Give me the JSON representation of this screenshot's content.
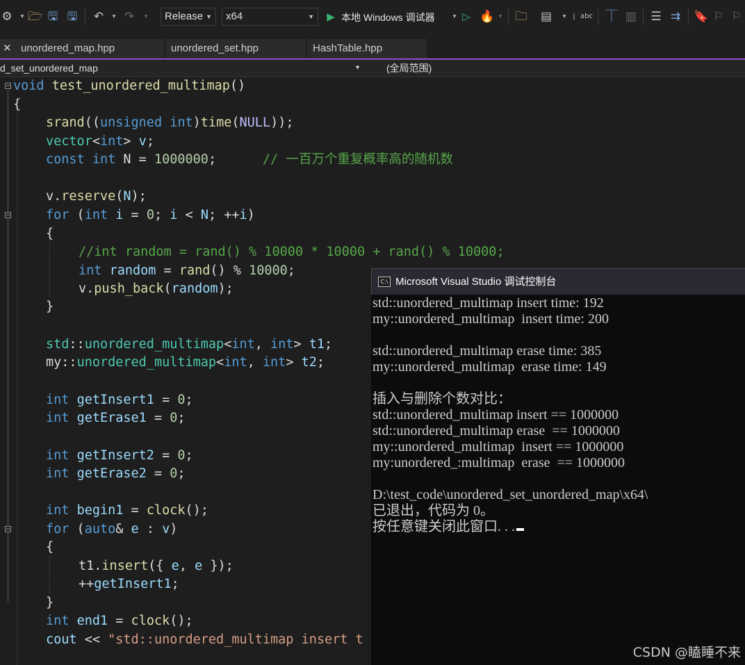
{
  "toolbar": {
    "configuration": "Release",
    "platform": "x64",
    "run_label": "本地 Windows 调试器",
    "icons": [
      "config-icon",
      "open-folder-icon",
      "save-icon",
      "save-all-icon",
      "undo-icon",
      "redo-icon",
      "play-icon",
      "play-outline-icon",
      "hot-reload-icon",
      "find-in-files-icon",
      "format-icon",
      "spellcheck-icon",
      "breakpoint-icon",
      "outdent-icon",
      "indent-icon",
      "comment-icon",
      "uncomment-icon",
      "bookmark-icon",
      "prev-bookmark-icon",
      "next-bookmark-icon"
    ]
  },
  "tabs": [
    {
      "label": "unordered_map.hpp"
    },
    {
      "label": "unordered_set.hpp"
    },
    {
      "label": "HashTable.hpp"
    }
  ],
  "navbar": {
    "project": "d_set_unordered_map",
    "scope": "(全局范围)"
  },
  "code": {
    "l01_a": "void",
    "l01_b": " ",
    "l01_c": "test_unordered_multimap",
    "l01_d": "()",
    "l02": "{",
    "l04_a": "srand",
    "l04_b": "((",
    "l04_c": "unsigned",
    "l04_d": " ",
    "l04_e": "int",
    "l04_f": ")",
    "l04_g": "time",
    "l04_h": "(",
    "l04_i": "NULL",
    "l04_j": "));",
    "l05_a": "vector",
    "l05_b": "<",
    "l05_c": "int",
    "l05_d": "> ",
    "l05_e": "v",
    "l05_f": ";",
    "l06_a": "const",
    "l06_b": " ",
    "l06_c": "int",
    "l06_d": " N = ",
    "l06_e": "1000000",
    "l06_f": ";      ",
    "l06_g": "// 一百万个重复概率高的随机数",
    "l08_a": "v.",
    "l08_b": "reserve",
    "l08_c": "(",
    "l08_d": "N",
    "l08_e": ");",
    "l09_a": "for",
    "l09_b": " (",
    "l09_c": "int",
    "l09_d": " ",
    "l09_e": "i",
    "l09_f": " = ",
    "l09_g": "0",
    "l09_h": "; ",
    "l09_i": "i",
    "l09_j": " < ",
    "l09_k": "N",
    "l09_l": "; ++",
    "l09_m": "i",
    "l09_n": ")",
    "l10": "{",
    "l11": "//int random = rand() % 10000 * 10000 + rand() % 10000;",
    "l12_a": "int",
    "l12_b": " ",
    "l12_c": "random",
    "l12_d": " = ",
    "l12_e": "rand",
    "l12_f": "() % ",
    "l12_g": "10000",
    "l12_h": ";",
    "l13_a": "v.",
    "l13_b": "push_back",
    "l13_c": "(",
    "l13_d": "random",
    "l13_e": ");",
    "l14": "}",
    "l16_a": "std",
    "l16_b": "::",
    "l16_c": "unordered_multimap",
    "l16_d": "<",
    "l16_e": "int",
    "l16_f": ", ",
    "l16_g": "int",
    "l16_h": "> ",
    "l16_i": "t1",
    "l16_j": ";",
    "l17_a": "my",
    "l17_b": "::",
    "l17_c": "unordered_multimap",
    "l17_d": "<",
    "l17_e": "int",
    "l17_f": ", ",
    "l17_g": "int",
    "l17_h": "> ",
    "l17_i": "t2",
    "l17_j": ";",
    "l19_a": "int",
    "l19_b": " ",
    "l19_c": "getInsert1",
    "l19_d": " = ",
    "l19_e": "0",
    "l19_f": ";",
    "l20_a": "int",
    "l20_b": " ",
    "l20_c": "getErase1",
    "l20_d": " = ",
    "l20_e": "0",
    "l20_f": ";",
    "l22_a": "int",
    "l22_b": " ",
    "l22_c": "getInsert2",
    "l22_d": " = ",
    "l22_e": "0",
    "l22_f": ";",
    "l23_a": "int",
    "l23_b": " ",
    "l23_c": "getErase2",
    "l23_d": " = ",
    "l23_e": "0",
    "l23_f": ";",
    "l25_a": "int",
    "l25_b": " ",
    "l25_c": "begin1",
    "l25_d": " = ",
    "l25_e": "clock",
    "l25_f": "();",
    "l26_a": "for",
    "l26_b": " (",
    "l26_c": "auto",
    "l26_d": "& ",
    "l26_e": "e",
    "l26_f": " : ",
    "l26_g": "v",
    "l26_h": ")",
    "l27": "{",
    "l28_a": "t1.",
    "l28_b": "insert",
    "l28_c": "({ ",
    "l28_d": "e",
    "l28_e": ", ",
    "l28_f": "e",
    "l28_g": " });",
    "l29_a": "++",
    "l29_b": "getInsert1",
    "l29_c": ";",
    "l30": "}",
    "l31_a": "int",
    "l31_b": " ",
    "l31_c": "end1",
    "l31_d": " = ",
    "l31_e": "clock",
    "l31_f": "();",
    "l32_a": "cout",
    "l32_b": " << ",
    "l32_c": "\"std::unordered_multimap insert t"
  },
  "console": {
    "title": "Microsoft Visual Studio 调试控制台",
    "icon_text": "C:\\",
    "lines": [
      "std::unordered_multimap insert time: 192",
      "my::unordered_multimap  insert time: 200",
      "",
      "std::unordered_multimap erase time: 385",
      "my::unordered_multimap  erase time: 149",
      "",
      "插入与删除个数对比：",
      "std::unordered_multimap insert == 1000000",
      "std::unordered_multimap erase  == 1000000",
      "my::unordered_multimap  insert == 1000000",
      "my:unordered_:multimap  erase  == 1000000",
      "",
      "D:\\test_code\\unordered_set_unordered_map\\x64\\",
      "已退出，代码为 0。",
      "按任意键关闭此窗口. . ."
    ]
  },
  "watermark": "CSDN @瞌睡不来",
  "colors": {
    "accent": "#8a4fd0",
    "keyword": "#569cd6",
    "function": "#dcdcaa",
    "type": "#4ec9b0",
    "number": "#b5cea8",
    "comment": "#57a64a",
    "run": "#3cb371"
  }
}
